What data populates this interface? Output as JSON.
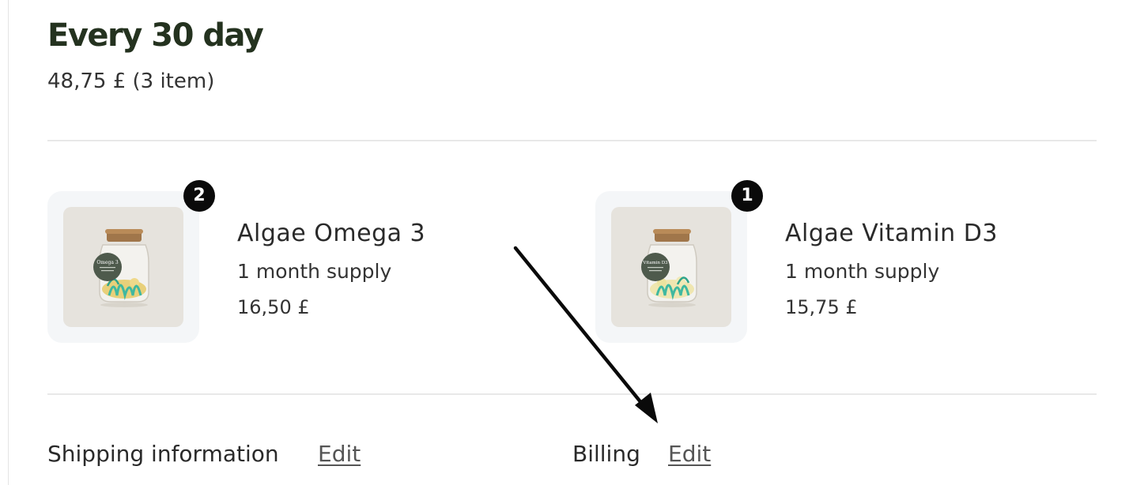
{
  "subscription": {
    "title": "Every 30 day",
    "summary": "48,75 £ (3 item)"
  },
  "products": [
    {
      "name": "Algae Omega 3",
      "supply": "1 month supply",
      "price": "16,50 £",
      "quantity": "2",
      "label_text": "Omega 3"
    },
    {
      "name": "Algae Vitamin D3",
      "supply": "1 month supply",
      "price": "15,75 £",
      "quantity": "1",
      "label_text": "Vitamin D3"
    }
  ],
  "sections": {
    "shipping_label": "Shipping information",
    "shipping_edit": "Edit",
    "billing_label": "Billing",
    "billing_edit": "Edit"
  },
  "colors": {
    "title": "#24321f",
    "badge": "#0a0a0a",
    "thumb_bg": "#e6e3dd",
    "jar_tag": "#4e5a4c",
    "algae": "#3fb8a0",
    "capsules": "#e8d07a"
  }
}
